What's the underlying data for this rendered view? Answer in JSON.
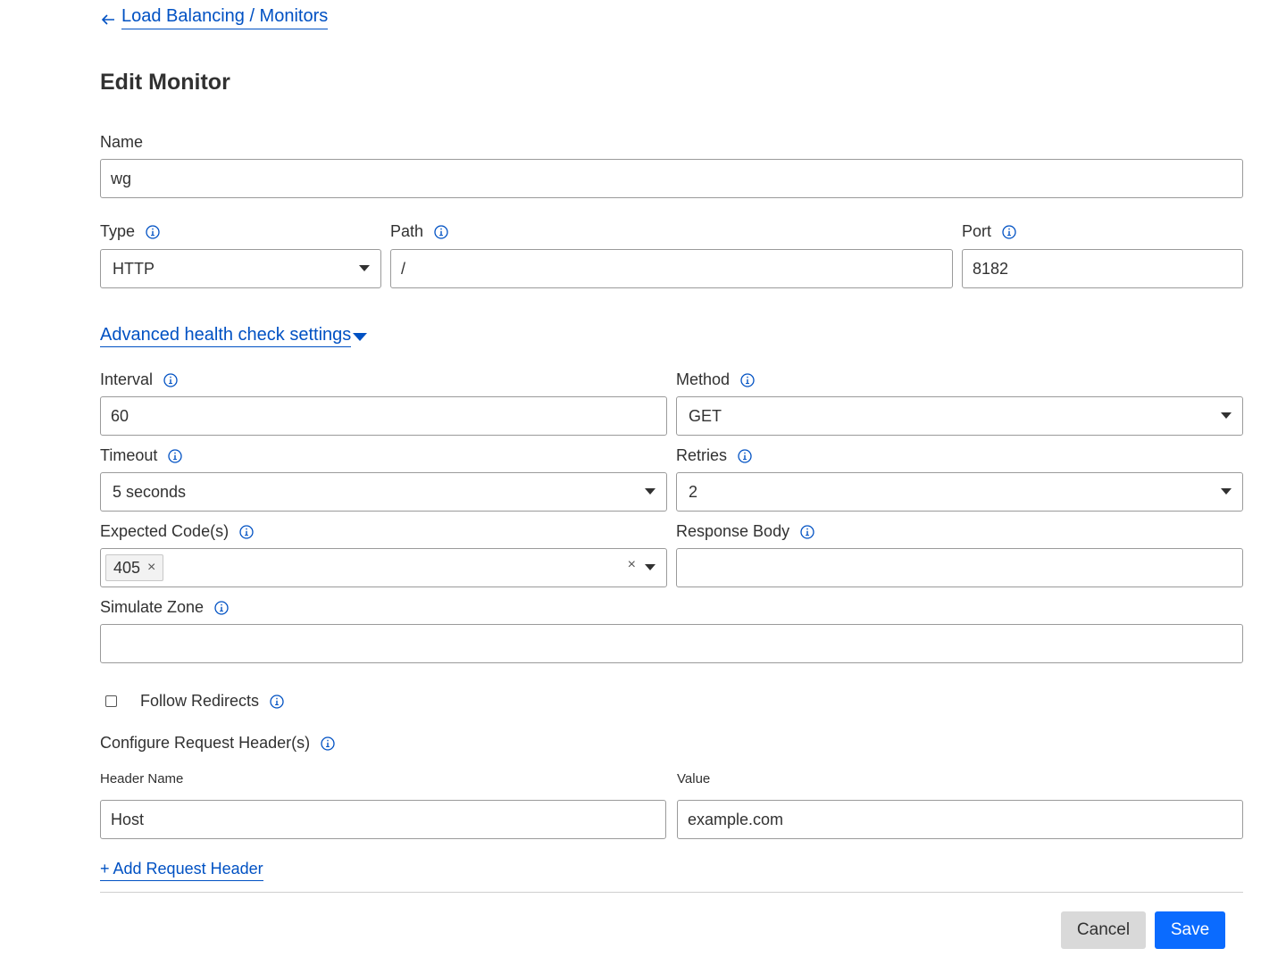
{
  "breadcrumb": {
    "label": "Load Balancing / Monitors"
  },
  "page": {
    "title": "Edit Monitor"
  },
  "name": {
    "label": "Name",
    "value": "wg"
  },
  "type": {
    "label": "Type",
    "value": "HTTP"
  },
  "path": {
    "label": "Path",
    "value": "/"
  },
  "port": {
    "label": "Port",
    "value": "8182"
  },
  "advanced": {
    "label": "Advanced health check settings"
  },
  "interval": {
    "label": "Interval",
    "value": "60"
  },
  "method": {
    "label": "Method",
    "value": "GET"
  },
  "timeout": {
    "label": "Timeout",
    "value": "5 seconds"
  },
  "retries": {
    "label": "Retries",
    "value": "2"
  },
  "expected_codes": {
    "label": "Expected Code(s)",
    "chips": [
      "405"
    ]
  },
  "response_body": {
    "label": "Response Body",
    "value": ""
  },
  "simulate_zone": {
    "label": "Simulate Zone",
    "value": ""
  },
  "follow_redirects": {
    "label": "Follow Redirects",
    "checked": false
  },
  "request_headers": {
    "label": "Configure Request Header(s)",
    "name_label": "Header Name",
    "value_label": "Value",
    "rows": [
      {
        "name": "Host",
        "value": "example.com"
      }
    ],
    "add_label": "+ Add Request Header"
  },
  "actions": {
    "cancel": "Cancel",
    "save": "Save"
  },
  "colors": {
    "accent": "#0051c3",
    "primary_button": "#0a6bff",
    "secondary_button": "#d9d9d9"
  },
  "icons": {
    "back": "arrow-left-icon",
    "info": "info-circle-icon",
    "caret": "caret-down-icon",
    "clear": "clear-x-icon"
  }
}
